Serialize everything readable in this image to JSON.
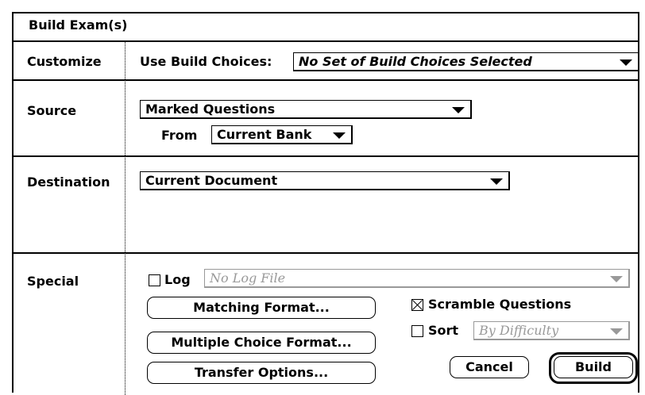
{
  "window": {
    "title": "Build Exam(s)"
  },
  "sections": {
    "customize": {
      "label": "Customize",
      "use_build_choices_label": "Use Build Choices:",
      "use_build_choices_value": "No Set of Build Choices Selected"
    },
    "source": {
      "label": "Source",
      "source_value": "Marked Questions",
      "from_label": "From",
      "from_value": "Current Bank"
    },
    "destination": {
      "label": "Destination",
      "destination_value": "Current Document"
    },
    "special": {
      "label": "Special",
      "log_label": "Log",
      "log_checked": false,
      "log_file_value": "No Log File",
      "matching_format_label": "Matching Format...",
      "multiple_choice_format_label": "Multiple Choice Format...",
      "transfer_options_label": "Transfer Options...",
      "scramble_label": "Scramble Questions",
      "scramble_checked": true,
      "sort_label": "Sort",
      "sort_checked": false,
      "sort_value": "By Difficulty"
    }
  },
  "buttons": {
    "cancel_label": "Cancel",
    "build_label": "Build"
  },
  "icons": [
    "popup-arrow-icon",
    "checkbox-icon"
  ]
}
